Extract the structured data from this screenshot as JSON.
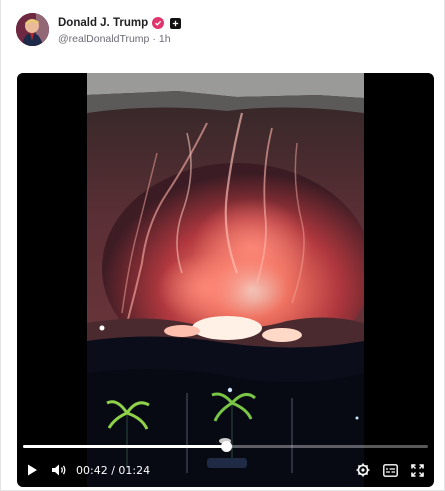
{
  "post": {
    "author_name": "Donald J. Trump",
    "handle": "@realDonaldTrump",
    "separator": "·",
    "time_ago": "1h"
  },
  "video": {
    "current_time": "00:42",
    "time_separator": "/",
    "duration": "01:24",
    "progress": 0.5,
    "icons": [
      "play-icon",
      "volume-icon",
      "settings-icon",
      "captions-icon",
      "fullscreen-icon"
    ]
  },
  "colors": {
    "verified_badge": "#e0356c",
    "video_background": "#000000",
    "fire_glow": "#ff5a4a"
  }
}
